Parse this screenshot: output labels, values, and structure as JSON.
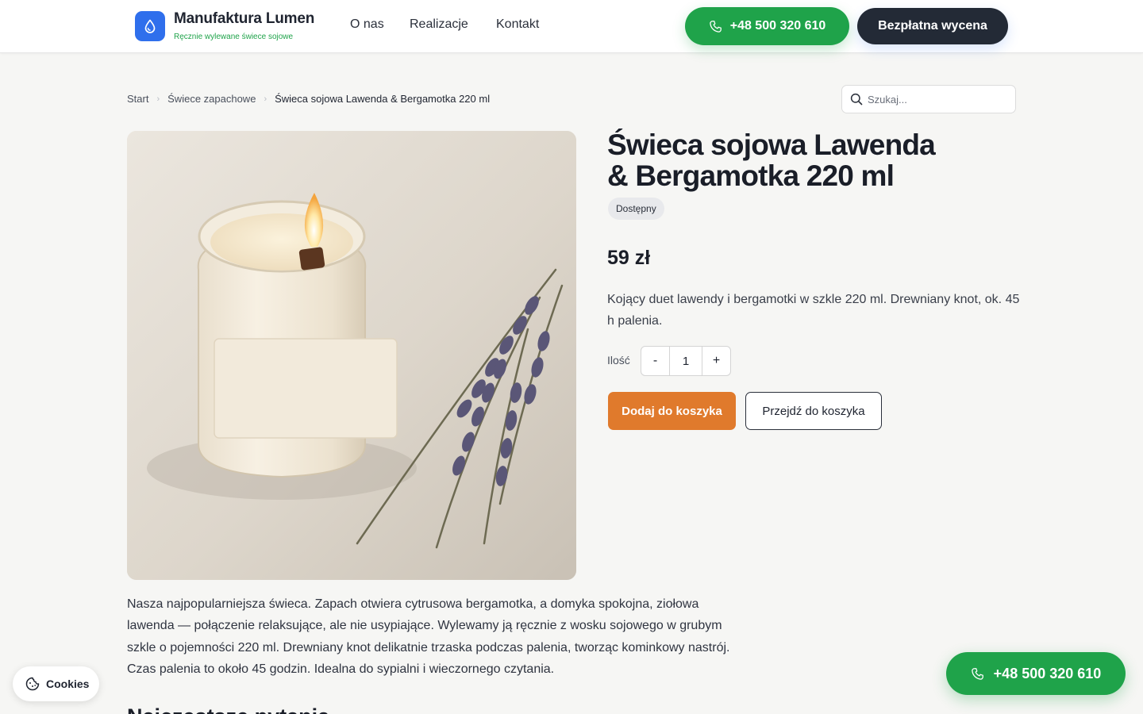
{
  "header": {
    "brand_name": "Manufaktura Lumen",
    "brand_tagline": "Ręcznie wylewane świece sojowe",
    "nav": [
      "O nas",
      "Realizacje",
      "Kontakt"
    ],
    "phone": "+48 500 320 610",
    "cta": "Bezpłatna wycena"
  },
  "breadcrumb": {
    "items": [
      "Start",
      "Świece zapachowe",
      "Świeca sojowa Lawenda & Bergamotka 220 ml"
    ]
  },
  "search": {
    "placeholder": "Szukaj..."
  },
  "product": {
    "title_line1": "Świeca sojowa Lawenda",
    "title_line2": "& Bergamotka 220 ml",
    "status": "Dostępny",
    "price": "59 zł",
    "short_description": "Kojący duet lawendy i bergamotki w szkle 220 ml. Drewniany knot, ok. 45 h palenia.",
    "quantity_label": "Ilość",
    "quantity": "1",
    "minus": "-",
    "plus": "+",
    "add_to_cart": "Dodaj do koszyka",
    "go_to_cart": "Przejdź do koszyka",
    "long_description": "Nasza najpopularniejsza świeca. Zapach otwiera cytrusowa bergamotka, a domyka spokojna, ziołowa lawenda — połączenie relaksujące, ale nie usypiające. Wylewamy ją ręcznie z wosku sojowego w grubym szkle o pojemności 220 ml. Drewniany knot delikatnie trzaska podczas palenia, tworząc kominkowy nastrój. Czas palenia to około 45 godzin. Idealna do sypialni i wieczornego czytania."
  },
  "section_heading": "Najczęstsze pytania",
  "cookies_label": "Cookies",
  "floating_phone": "+48 500 320 610",
  "icons": {
    "logo": "drop-icon",
    "phone": "phone-icon",
    "search": "search-icon",
    "cookies": "cookie-icon"
  },
  "colors": {
    "brand_blue": "#2f6fec",
    "green": "#1fa34a",
    "dark": "#232a36",
    "orange": "#e07a2c",
    "background": "#f6f6f4"
  }
}
